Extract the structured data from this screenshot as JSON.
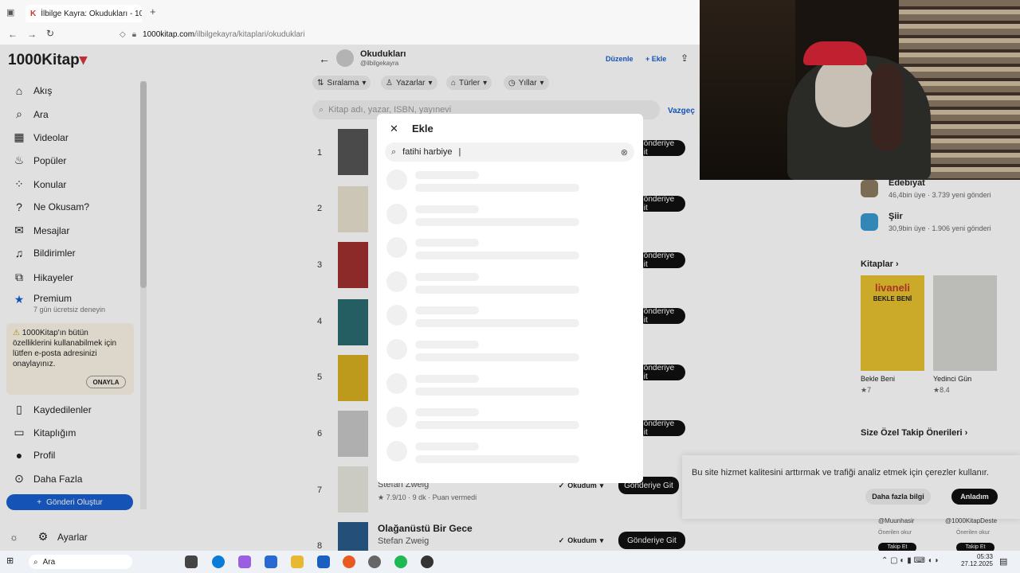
{
  "browser": {
    "tab_title": "İlbilge Kayra: Okudukları - 1000",
    "url_host": "1000kitap.com",
    "url_path": "/ilbilgekayra/kitaplari/okuduklari"
  },
  "site": {
    "logo": "1000Kitap",
    "nav": [
      {
        "icon": "home-icon",
        "label": "Akış"
      },
      {
        "icon": "search-icon",
        "label": "Ara"
      },
      {
        "icon": "video-icon",
        "label": "Videolar"
      },
      {
        "icon": "flame-icon",
        "label": "Popüler"
      },
      {
        "icon": "topics-icon",
        "label": "Konular"
      },
      {
        "icon": "help-icon",
        "label": "Ne Okusam?"
      },
      {
        "icon": "mail-icon",
        "label": "Mesajlar"
      },
      {
        "icon": "bell-icon",
        "label": "Bildirimler"
      },
      {
        "icon": "stories-icon",
        "label": "Hikayeler"
      }
    ],
    "premium": {
      "label": "Premium",
      "sub": "7 gün ücretsiz deneyin"
    },
    "warning": {
      "text": "1000Kitap'ın bütün özelliklerini kullanabilmek için lütfen e-posta adresinizi onaylayınız.",
      "button": "ONAYLA"
    },
    "nav2": [
      {
        "icon": "bookmark-icon",
        "label": "Kaydedilenler"
      },
      {
        "icon": "library-icon",
        "label": "Kitaplığım"
      },
      {
        "icon": "avatar-icon",
        "label": "Profil"
      },
      {
        "icon": "more-icon",
        "label": "Daha Fazla"
      }
    ],
    "create_post": "Gönderi Oluştur",
    "settings": "Ayarlar",
    "header": {
      "title": "Okudukları",
      "handle": "@ilbilgekayra",
      "edit": "Düzenle",
      "add": "Ekle"
    },
    "filters": [
      "Sıralama",
      "Yazarlar",
      "Türler",
      "Yıllar"
    ],
    "search_placeholder": "Kitap adı, yazar, ISBN, yayınevi",
    "cancel": "Vazgeç",
    "rows": [
      {
        "rank": "1",
        "btn": "Gönderiye Git"
      },
      {
        "rank": "2",
        "btn": "Gönderiye Git"
      },
      {
        "rank": "3",
        "btn": "Gönderiye Git"
      },
      {
        "rank": "4",
        "btn": "Gönderiye Git"
      },
      {
        "rank": "5",
        "btn": "Gönderiye Git"
      },
      {
        "rank": "6",
        "btn": "Gönderiye Git"
      },
      {
        "rank": "7",
        "author": "Stefan Zweig",
        "meta": "7.9/10 · 9 dk · Puan vermedi",
        "status": "Okudum",
        "btn": "Gönderiye Git"
      },
      {
        "rank": "8",
        "title": "Olağanüstü Bir Gece",
        "author": "Stefan Zweig",
        "status": "Okudum",
        "btn": "Gönderiye Git"
      }
    ],
    "right": {
      "groups": [
        {
          "name": "Edebiyat",
          "meta": "46,4bin üye · 3.739 yeni gönderi"
        },
        {
          "name": "Şiir",
          "meta": "30,9bin üye · 1.906 yeni gönderi"
        }
      ],
      "books_title": "Kitaplar",
      "books": [
        {
          "title": "Bekle Beni",
          "rating": "7",
          "cover_text": "BEKLE BENİ",
          "cover_brand": "livaneli"
        },
        {
          "title": "Yedinci Gün",
          "rating": "8.4"
        }
      ],
      "suggest_title": "Size Özel Takip Önerileri",
      "suggest": [
        {
          "handle": "@Muunhasir",
          "note": "Önerilen okur",
          "btn": "Takip Et"
        },
        {
          "handle": "@1000KitapDeste",
          "note": "Önerilen okur",
          "btn": "Takip Et"
        }
      ]
    },
    "cookie": {
      "text": "Bu site hizmet kalitesini arttırmak ve trafiği analiz etmek için çerezler kullanır.",
      "more": "Daha fazla bilgi",
      "ok": "Anladım"
    }
  },
  "modal": {
    "title": "Ekle",
    "query": "fatihi harbiye"
  },
  "taskbar": {
    "search": "Ara",
    "time": "05:33",
    "date": "27.12.2025"
  }
}
